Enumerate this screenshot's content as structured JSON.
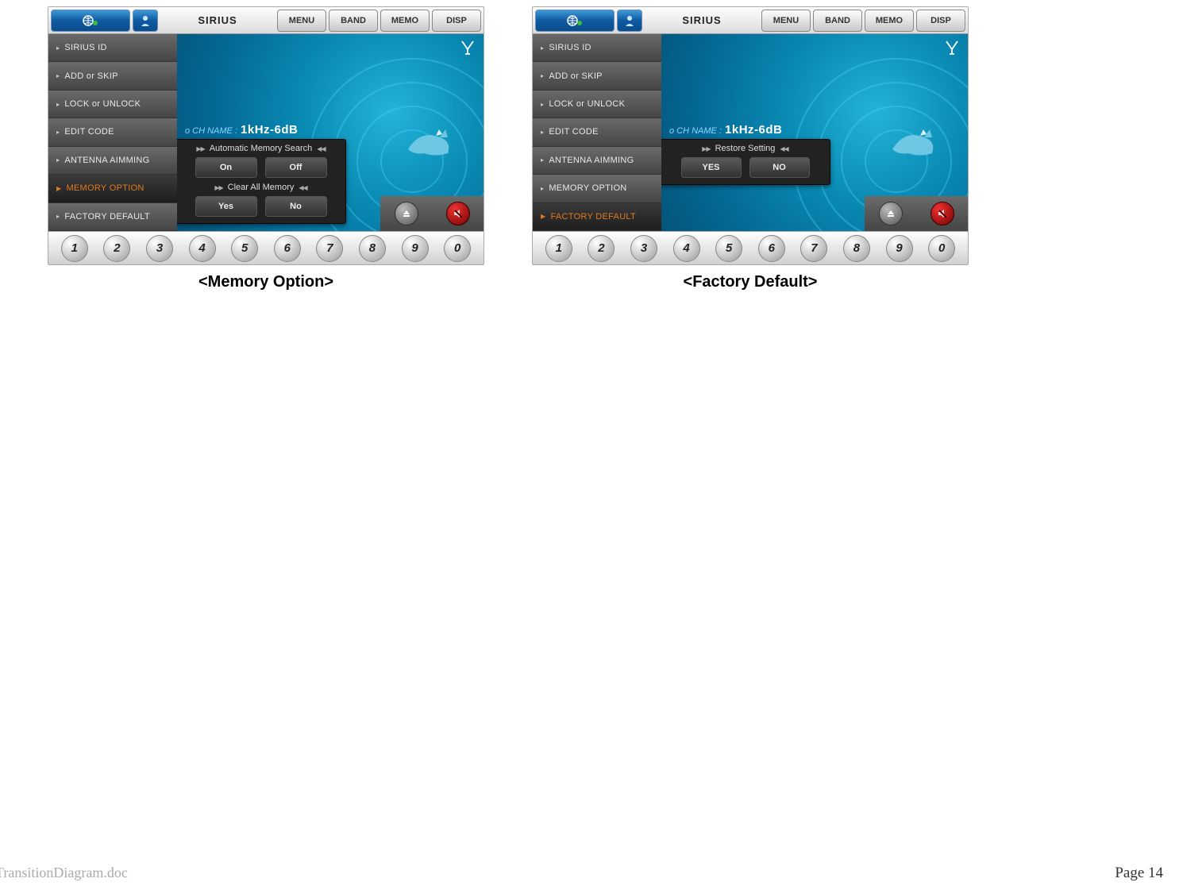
{
  "captions": {
    "memory": "<Memory Option>",
    "factory": "<Factory Default>"
  },
  "top_buttons": [
    "MENU",
    "BAND",
    "MEMO",
    "DISP"
  ],
  "source_label": "SIRIUS",
  "sidebar_items": [
    "SIRIUS ID",
    "ADD or SKIP",
    "LOCK or UNLOCK",
    "EDIT CODE",
    "ANTENNA AIMMING",
    "MEMORY OPTION",
    "FACTORY DEFAULT"
  ],
  "channel": {
    "prefix": "o CH NAME :",
    "value": "1kHz-6dB"
  },
  "memory_popup": {
    "line1": "Automatic Memory Search",
    "btn1a": "On",
    "btn1b": "Off",
    "line2": "Clear All Memory",
    "btn2a": "Yes",
    "btn2b": "No"
  },
  "factory_popup": {
    "line1": "Restore Setting",
    "btn1a": "YES",
    "btn1b": "NO"
  },
  "preset_numbers": [
    "1",
    "2",
    "3",
    "4",
    "5",
    "6",
    "7",
    "8",
    "9",
    "0"
  ],
  "footer": {
    "left": "TransitionDiagram.doc",
    "right": "Page 14"
  },
  "active_index": {
    "memory": 5,
    "factory": 6
  }
}
